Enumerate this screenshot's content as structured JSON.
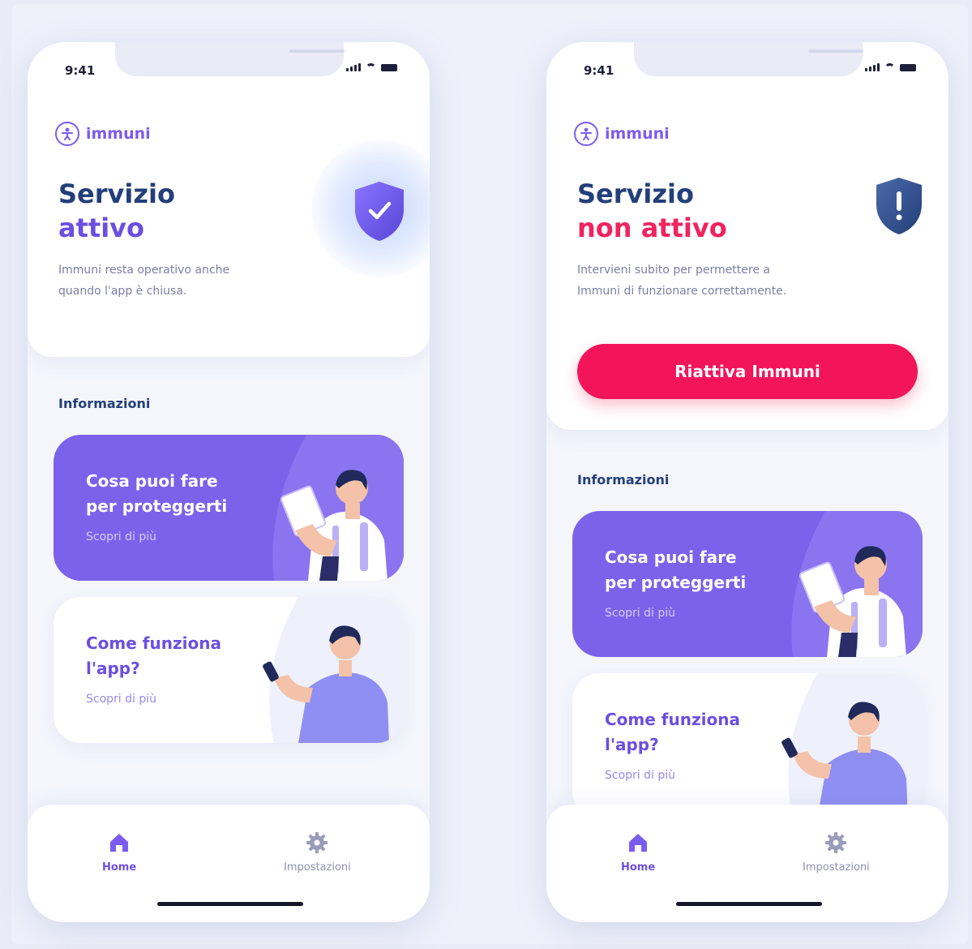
{
  "colors": {
    "brand_purple": "#7a5cf0",
    "title_navy": "#233f7a",
    "alert_red": "#f0245f",
    "cta_pink": "#f2155a",
    "card_purple": "#7b62ea"
  },
  "phones": [
    {
      "status": {
        "time": "9:41"
      },
      "brand": {
        "name": "immuni",
        "icon": "immuni-logo-icon"
      },
      "header": {
        "title_line1": "Servizio",
        "title_line2": "attivo",
        "description": "Immuni resta operativo anche quando l'app è chiusa.",
        "shield_icon": "shield-check-icon"
      },
      "section_title": "Informazioni",
      "cards": [
        {
          "title": "Cosa puoi fare per proteggerti",
          "link": "Scopri di più"
        },
        {
          "title": "Come funziona l'app?",
          "link": "Scopri di più"
        }
      ],
      "tabbar": {
        "home": "Home",
        "settings": "Impostazioni"
      }
    },
    {
      "status": {
        "time": "9:41"
      },
      "brand": {
        "name": "immuni",
        "icon": "immuni-logo-icon"
      },
      "header": {
        "title_line1": "Servizio",
        "title_line2": "non attivo",
        "description": "Intervieni subito per permettere a Immuni di funzionare correttamente.",
        "shield_icon": "shield-alert-icon",
        "cta": "Riattiva Immuni"
      },
      "section_title": "Informazioni",
      "cards": [
        {
          "title": "Cosa puoi fare per proteggerti",
          "link": "Scopri di più"
        },
        {
          "title": "Come funziona l'app?",
          "link": "Scopri di più"
        }
      ],
      "tabbar": {
        "home": "Home",
        "settings": "Impostazioni"
      }
    }
  ]
}
